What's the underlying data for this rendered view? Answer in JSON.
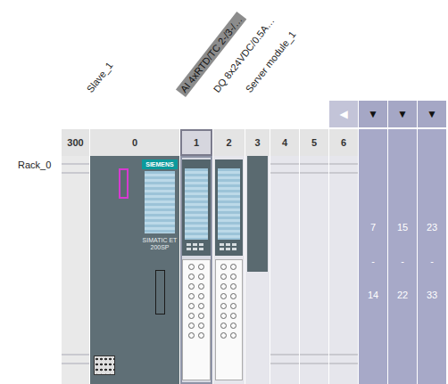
{
  "rack": {
    "label": "Rack_0"
  },
  "navigation": {
    "prev": "◀"
  },
  "head_module": {
    "brand": "SIEMENS",
    "model": "SIMATIC ET 200SP"
  },
  "slots": [
    {
      "number": "300",
      "kind": "rail",
      "selected": false
    },
    {
      "number": "0",
      "kind": "head",
      "label": "Slave_1",
      "selected": false
    },
    {
      "number": "1",
      "kind": "io",
      "label": "AI 4xRTD/TC 2-/3-/…",
      "selected": true
    },
    {
      "number": "2",
      "kind": "io",
      "label": "DQ 8x24VDC/0.5A…",
      "selected": false
    },
    {
      "number": "3",
      "kind": "server",
      "label": "Server module_1",
      "selected": false
    },
    {
      "number": "4",
      "kind": "empty",
      "selected": false
    },
    {
      "number": "5",
      "kind": "empty",
      "selected": false
    },
    {
      "number": "6",
      "kind": "empty",
      "selected": false
    },
    {
      "number": "…14",
      "kind": "group",
      "toggle": "▼",
      "from": "7",
      "sep": "-",
      "to": "14",
      "selected": false
    },
    {
      "number": "…22",
      "kind": "group",
      "toggle": "▼",
      "from": "15",
      "sep": "-",
      "to": "22",
      "selected": false
    },
    {
      "number": "…33",
      "kind": "group",
      "toggle": "▼",
      "from": "23",
      "sep": "-",
      "to": "33",
      "selected": false
    }
  ]
}
